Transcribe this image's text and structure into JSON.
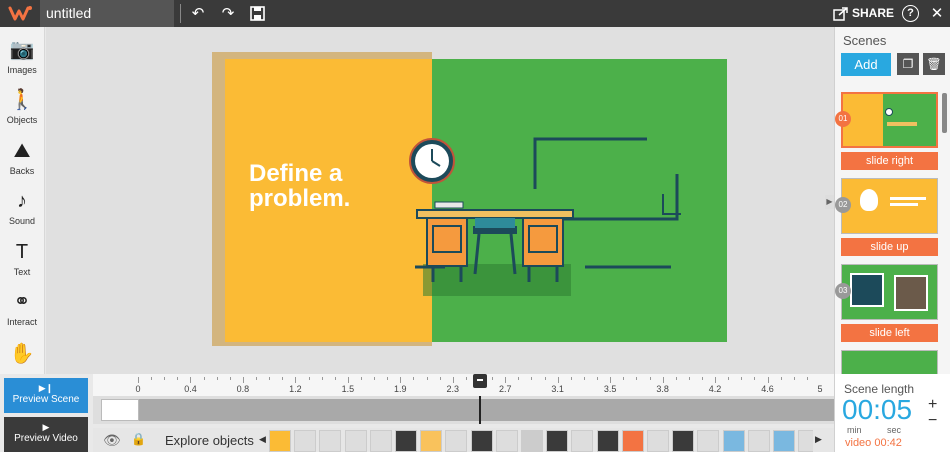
{
  "topbar": {
    "title": "untitled",
    "share_label": "SHARE",
    "undo_icon": "↶",
    "redo_icon": "↷",
    "save_icon": "💾",
    "help_icon": "?",
    "close_icon": "✕"
  },
  "tools": [
    {
      "label": "Images",
      "icon": "📷"
    },
    {
      "label": "Objects",
      "icon": "🚶"
    },
    {
      "label": "Backs",
      "icon": "⛰"
    },
    {
      "label": "Sound",
      "icon": "♪"
    },
    {
      "label": "Text",
      "icon": "T"
    },
    {
      "label": "Interact",
      "icon": "⚭"
    },
    {
      "label": "",
      "icon": "✋"
    }
  ],
  "scene": {
    "headline_line1": "Define a",
    "headline_line2": "problem."
  },
  "scenes_panel": {
    "title": "Scenes",
    "add_label": "Add",
    "scenes": [
      {
        "number": "01",
        "transition": "slide right"
      },
      {
        "number": "02",
        "transition": "slide up"
      },
      {
        "number": "03",
        "transition": "slide left"
      }
    ]
  },
  "timeline": {
    "preview_scene": "Preview Scene",
    "preview_video": "Preview Video",
    "ticks": [
      "0",
      "0.4",
      "0.8",
      "1.2",
      "1.5",
      "1.9",
      "2.3",
      "2.7",
      "3.1",
      "3.5",
      "3.8",
      "4.2",
      "4.6",
      "5"
    ],
    "explore_label": "Explore objects"
  },
  "scene_length": {
    "title": "Scene length",
    "value": "00:05",
    "min_label": "min",
    "sec_label": "sec",
    "video_label": "video 00:42",
    "plus": "+",
    "minus": "−"
  },
  "colors": {
    "accent": "#29a8e0",
    "transition": "#f37342",
    "scene_yellow": "#fbbb35",
    "scene_green": "#4cb04a"
  }
}
